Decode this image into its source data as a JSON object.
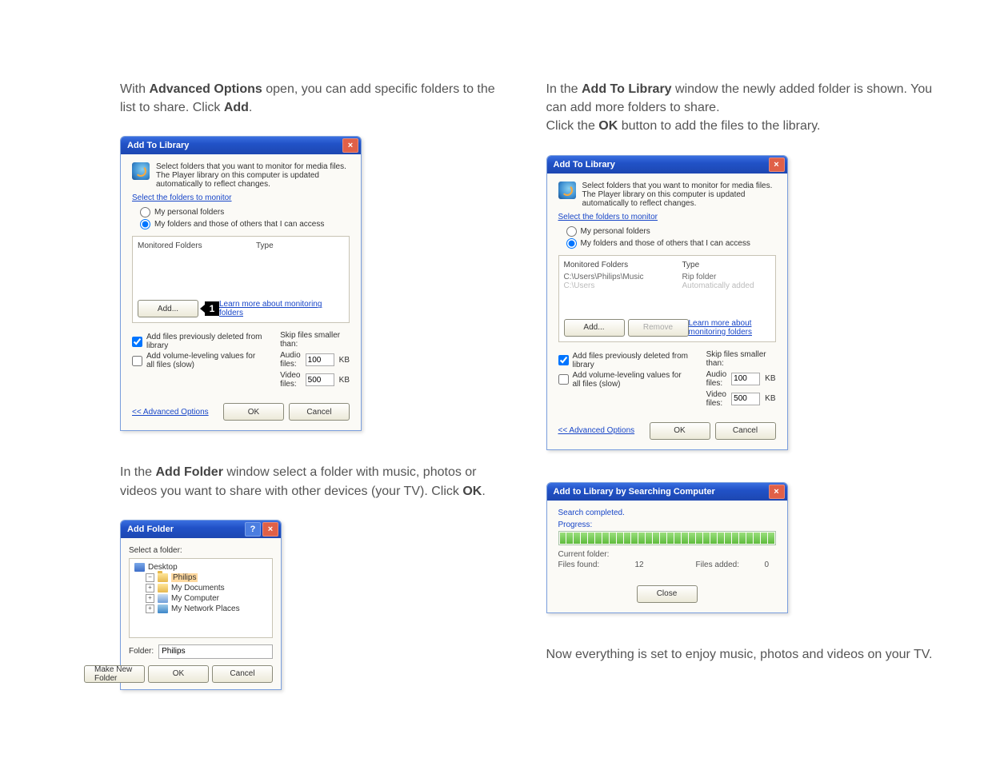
{
  "leftCol": {
    "instr1_a": "With ",
    "instr1_b": "Advanced Options",
    "instr1_c": " open, you can add specific folders to the list to share. Click ",
    "instr1_d": "Add",
    "instr1_e": ".",
    "instr2_a": "In the ",
    "instr2_b": "Add Folder",
    "instr2_c": " window select a folder with music, photos or videos you want to share with other devices (your TV). Click ",
    "instr2_d": "OK",
    "instr2_e": "."
  },
  "rightCol": {
    "instr1_a": "In the ",
    "instr1_b": "Add To Library",
    "instr1_c": " window the newly added folder is shown. You can add more folders to share.",
    "instr1_d": "Click the ",
    "instr1_e": "OK",
    "instr1_f": " button to add the files to the library.",
    "instr2": "Now everything is set to enjoy music, photos and videos on your TV."
  },
  "addToLib": {
    "title": "Add To Library",
    "topmsg": "Select folders that you want to monitor for media files. The Player library on this computer is updated automatically to reflect changes.",
    "selectLink": "Select the folders to monitor",
    "radio1": "My personal folders",
    "radio2": "My folders and those of others that I can access",
    "colFolders": "Monitored Folders",
    "colType": "Type",
    "row1path": "C:\\Users\\Philips\\Music",
    "row1type": "Rip folder",
    "row2path": "C:\\Users",
    "row2type": "Automatically added",
    "addBtn": "Add...",
    "removeBtn": "Remove",
    "learnLink": "Learn more about monitoring folders",
    "chk1": "Add files previously deleted from library",
    "chk2": "Add volume-leveling values for all files (slow)",
    "skipLabel": "Skip files smaller than:",
    "audioLbl": "Audio files:",
    "audioVal": "100",
    "videoLbl": "Video files:",
    "videoVal": "500",
    "kb": "KB",
    "advLink": "<< Advanced Options",
    "ok": "OK",
    "cancel": "Cancel",
    "callout": "1"
  },
  "addFolder": {
    "title": "Add Folder",
    "selectLbl": "Select a folder:",
    "desktop": "Desktop",
    "philips": "Philips",
    "mydocs": "My Documents",
    "mycomp": "My Computer",
    "mynet": "My Network Places",
    "folderLbl": "Folder:",
    "folderVal": "Philips",
    "makeNew": "Make New Folder",
    "ok": "OK",
    "cancel": "Cancel"
  },
  "progress": {
    "title": "Add to Library by Searching Computer",
    "searchDone": "Search completed.",
    "progressLbl": "Progress:",
    "curFolderLbl": "Current folder:",
    "curFolderVal": "",
    "filesFoundLbl": "Files found:",
    "filesFoundVal": "12",
    "filesAddedLbl": "Files added:",
    "filesAddedVal": "0",
    "close": "Close"
  }
}
